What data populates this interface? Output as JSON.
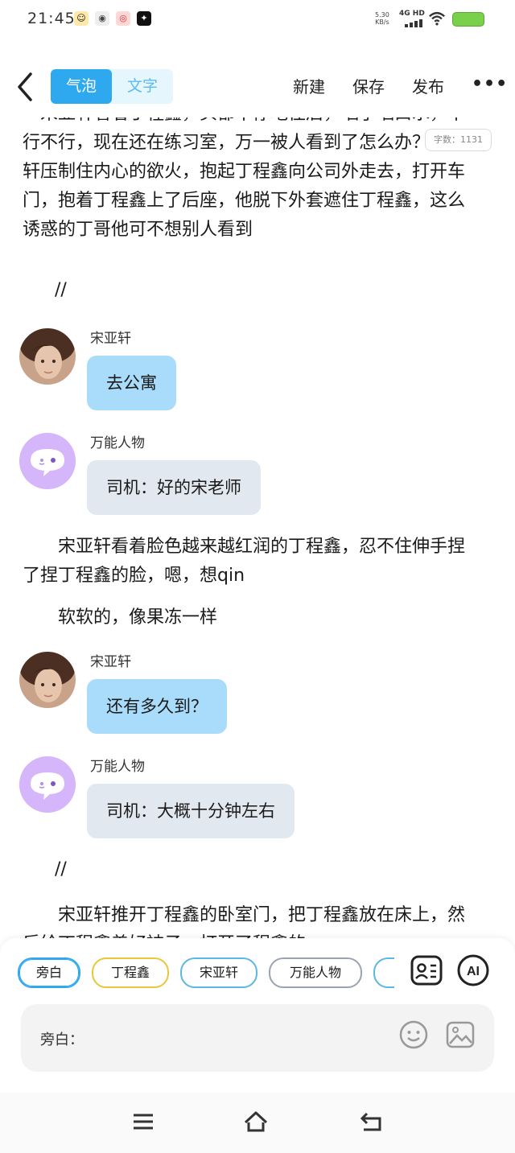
{
  "status_bar": {
    "time": "21:45",
    "net_speed_value": "5.30",
    "net_speed_unit": "KB/s",
    "network": "4G HD",
    "battery_value": "",
    "icons": [
      "baby-face-icon",
      "wechat-icon",
      "weibo-icon",
      "sparkle-app-icon"
    ]
  },
  "toolbar": {
    "mode_tabs": [
      "气泡",
      "文字"
    ],
    "active_mode": "气泡",
    "actions": [
      "新建",
      "保存",
      "发布"
    ]
  },
  "word_count": "字数：1131",
  "story": {
    "paragraph_1": "　宋亚轩看着丁程鑫，头都不停地往后，咽了咽口水，不行不行，现在还在练习室，万一被人看到了怎么办？宋亚轩压制住内心的欲火，抱起丁程鑫向公司外走去，打开车门，抱着丁程鑫上了后座，他脱下外套遮住丁程鑫，这么诱惑的丁哥他可不想别人看到",
    "separator_1": "//",
    "msg_1": {
      "speaker": "宋亚轩",
      "text": "去公寓"
    },
    "msg_2": {
      "speaker": "万能人物",
      "text": "司机：好的宋老师"
    },
    "paragraph_2": "　　宋亚轩看着脸色越来越红润的丁程鑫，忍不住伸手捏了捏丁程鑫的脸，嗯，想qin",
    "paragraph_3": "　　软软的，像果冻一样",
    "msg_3": {
      "speaker": "宋亚轩",
      "text": "还有多久到？"
    },
    "msg_4": {
      "speaker": "万能人物",
      "text": "司机：大概十分钟左右"
    },
    "separator_2": "//",
    "paragraph_4": "　　宋亚轩推开丁程鑫的卧室门，把丁程鑫放在床上，然后给丁程鑫盖好被子，打开了程鑫的"
  },
  "role_chips": [
    "旁白",
    "丁程鑫",
    "宋亚轩",
    "万能人物"
  ],
  "chip_colors": [
    "#2ea9ef",
    "#e9c63a",
    "#5ab7e6",
    "#9aa4b0"
  ],
  "input": {
    "label": "旁白："
  },
  "panel_icons": [
    "contact-card-icon",
    "ai-icon",
    "emoji-icon",
    "image-icon"
  ],
  "nav_icons": [
    "menu-icon",
    "home-icon",
    "back-arrow-icon"
  ],
  "ai_label": "AI"
}
